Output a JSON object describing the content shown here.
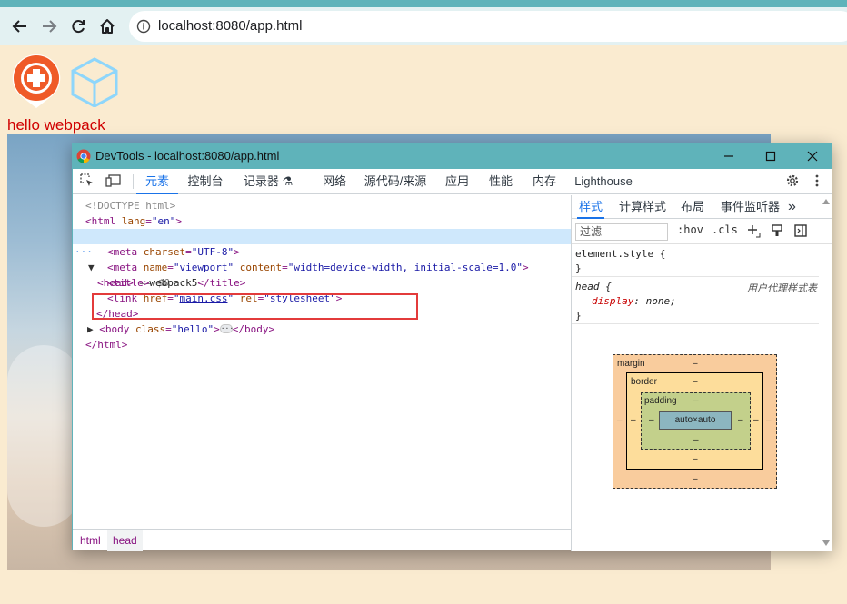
{
  "browser": {
    "url": "localhost:8080/app.html"
  },
  "page": {
    "heading": "hello webpack"
  },
  "devtools": {
    "title": "DevTools - localhost:8080/app.html",
    "tabs": [
      {
        "label": "元素",
        "active": true
      },
      {
        "label": "控制台",
        "active": false
      },
      {
        "label": "记录器 ⚗",
        "active": false
      },
      {
        "label": "网络",
        "active": false
      },
      {
        "label": "源代码/来源",
        "active": false
      },
      {
        "label": "应用",
        "active": false
      },
      {
        "label": "性能",
        "active": false
      },
      {
        "label": "内存",
        "active": false
      },
      {
        "label": "Lighthouse",
        "active": false
      }
    ],
    "dom": {
      "doctype": "<!DOCTYPE html>",
      "html_open_tag": "<html",
      "html_lang_attr": "lang",
      "html_lang_val": "\"en\"",
      "gt": ">",
      "head_open": "<head>",
      "head_marker": "== $0",
      "meta1_tag": "<meta",
      "meta1_attr": "charset",
      "meta1_val": "\"UTF-8\"",
      "meta2_tag": "<meta",
      "meta2_name_attr": "name",
      "meta2_name_val": "\"viewport\"",
      "meta2_content_attr": "content",
      "meta2_content_val": "\"width=device-width, initial-scale=1.0\"",
      "title_open": "<title>",
      "title_text": "webpack5",
      "title_close": "</title>",
      "link_tag": "<link",
      "link_href_attr": "href",
      "link_href_val": "main.css",
      "link_rel_attr": "rel",
      "link_rel_val": "\"stylesheet\"",
      "head_close": "</head>",
      "body_open": "<body",
      "body_class_attr": "class",
      "body_class_val": "\"hello\"",
      "body_dots": "···",
      "body_close": "</body>",
      "html_close": "</html>",
      "eq": "=",
      "quote": "\""
    },
    "breadcrumbs": [
      "html",
      "head"
    ],
    "styles": {
      "tabs": [
        {
          "label": "样式",
          "active": true
        },
        {
          "label": "计算样式",
          "active": false
        },
        {
          "label": "布局",
          "active": false
        },
        {
          "label": "事件监听器",
          "active": false
        }
      ],
      "more": "»",
      "filter_placeholder": "过滤",
      "hov": ":hov",
      "cls": ".cls",
      "element_style_selector": "element.style {",
      "close_brace": "}",
      "head_selector": "head {",
      "ua_label": "用户代理样式表",
      "prop_name": "display",
      "prop_value": "none;"
    },
    "box_model": {
      "margin_label": "margin",
      "border_label": "border",
      "padding_label": "padding",
      "content": "auto×auto",
      "dash": "–"
    }
  },
  "colors": {
    "accent": "#1a73e8",
    "titlebar": "#5fb3ba",
    "highlight_box": "#e33b3b",
    "hello_text": "#d00000"
  }
}
